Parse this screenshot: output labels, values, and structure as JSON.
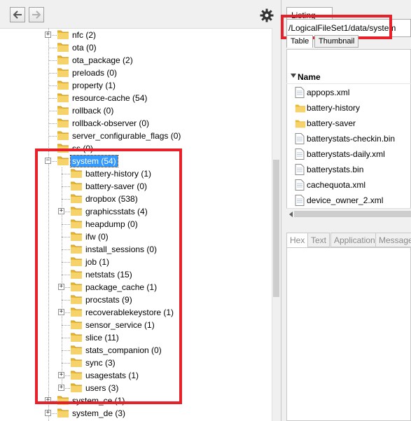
{
  "toolbar": {
    "back_icon": "arrow-left-icon",
    "forward_icon": "arrow-right-icon",
    "settings_icon": "gear-icon"
  },
  "tree": {
    "items": [
      {
        "label": "nfc (2)",
        "depth": 0,
        "expander": "+"
      },
      {
        "label": "ota (0)",
        "depth": 0,
        "expander": ""
      },
      {
        "label": "ota_package (2)",
        "depth": 0,
        "expander": ""
      },
      {
        "label": "preloads (0)",
        "depth": 0,
        "expander": ""
      },
      {
        "label": "property (1)",
        "depth": 0,
        "expander": ""
      },
      {
        "label": "resource-cache (54)",
        "depth": 0,
        "expander": ""
      },
      {
        "label": "rollback (0)",
        "depth": 0,
        "expander": ""
      },
      {
        "label": "rollback-observer (0)",
        "depth": 0,
        "expander": ""
      },
      {
        "label": "server_configurable_flags (0)",
        "depth": 0,
        "expander": ""
      },
      {
        "label": "ss (0)",
        "depth": 0,
        "expander": ""
      },
      {
        "label": "system (54)",
        "depth": 0,
        "expander": "-",
        "selected": true
      },
      {
        "label": "battery-history (1)",
        "depth": 1,
        "expander": ""
      },
      {
        "label": "battery-saver (0)",
        "depth": 1,
        "expander": ""
      },
      {
        "label": "dropbox (538)",
        "depth": 1,
        "expander": ""
      },
      {
        "label": "graphicsstats (4)",
        "depth": 1,
        "expander": "+"
      },
      {
        "label": "heapdump (0)",
        "depth": 1,
        "expander": ""
      },
      {
        "label": "ifw (0)",
        "depth": 1,
        "expander": ""
      },
      {
        "label": "install_sessions (0)",
        "depth": 1,
        "expander": ""
      },
      {
        "label": "job (1)",
        "depth": 1,
        "expander": ""
      },
      {
        "label": "netstats (15)",
        "depth": 1,
        "expander": ""
      },
      {
        "label": "package_cache (1)",
        "depth": 1,
        "expander": "+"
      },
      {
        "label": "procstats (9)",
        "depth": 1,
        "expander": ""
      },
      {
        "label": "recoverablekeystore (1)",
        "depth": 1,
        "expander": "+"
      },
      {
        "label": "sensor_service (1)",
        "depth": 1,
        "expander": ""
      },
      {
        "label": "slice (11)",
        "depth": 1,
        "expander": ""
      },
      {
        "label": "stats_companion (0)",
        "depth": 1,
        "expander": ""
      },
      {
        "label": "sync (3)",
        "depth": 1,
        "expander": ""
      },
      {
        "label": "usagestats (1)",
        "depth": 1,
        "expander": "+"
      },
      {
        "label": "users (3)",
        "depth": 1,
        "expander": "+"
      },
      {
        "label": "system_ce (1)",
        "depth": 0,
        "expander": "+"
      },
      {
        "label": "system_de (3)",
        "depth": 0,
        "expander": "+"
      }
    ]
  },
  "right": {
    "listing_tab": "Listing",
    "path": "/LogicalFileSet1/data/system",
    "sub_tabs": [
      "Table",
      "Thumbnail"
    ],
    "column_name": "Name",
    "files": [
      {
        "name": "appops.xml",
        "type": "file-icon"
      },
      {
        "name": "battery-history",
        "type": "folder-icon"
      },
      {
        "name": "battery-saver",
        "type": "folder-icon"
      },
      {
        "name": "batterystats-checkin.bin",
        "type": "file-icon"
      },
      {
        "name": "batterystats-daily.xml",
        "type": "file-icon"
      },
      {
        "name": "batterystats.bin",
        "type": "file-icon"
      },
      {
        "name": "cachequota.xml",
        "type": "file-icon"
      },
      {
        "name": "device_owner_2.xml",
        "type": "file-icon"
      }
    ],
    "bottom_tabs": [
      "Hex",
      "Text",
      "Application",
      "Message"
    ]
  },
  "colors": {
    "highlight": "#e8202a",
    "selection": "#3399ff",
    "folder": "#f2c84b"
  }
}
